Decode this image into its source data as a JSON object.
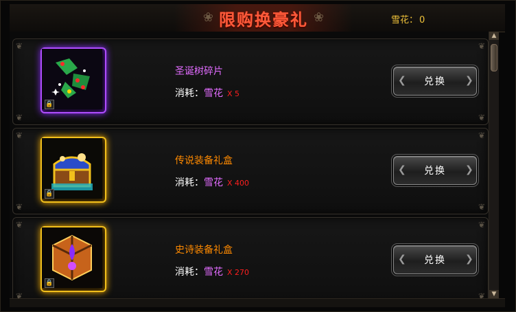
{
  "header": {
    "title": "限购换豪礼",
    "currency_label": "雪花：",
    "currency_value": "0"
  },
  "items": [
    {
      "name": "圣诞树碎片",
      "cost_label": "消耗：",
      "cost_currency": "雪花",
      "cost_qty": "X 5",
      "button": "兑换",
      "frame_color": "#b04dff"
    },
    {
      "name": "传说装备礼盒",
      "cost_label": "消耗：",
      "cost_currency": "雪花",
      "cost_qty": "X 400",
      "button": "兑换",
      "frame_color": "#f2c01c"
    },
    {
      "name": "史诗装备礼盒",
      "cost_label": "消耗：",
      "cost_currency": "雪花",
      "cost_qty": "X 270",
      "button": "兑换",
      "frame_color": "#f2c01c"
    }
  ],
  "icons": {
    "item_1": "christmas-tree-fragment-icon",
    "item_2": "legendary-treasure-chest-icon",
    "item_3": "epic-gift-box-icon",
    "lock": "lock-icon"
  },
  "colors": {
    "title": "#ff5a3a",
    "currency": "#f0c33a",
    "name_purple": "#e26cff",
    "name_orange": "#ff8a00",
    "qty_red": "#ff1f1f"
  }
}
